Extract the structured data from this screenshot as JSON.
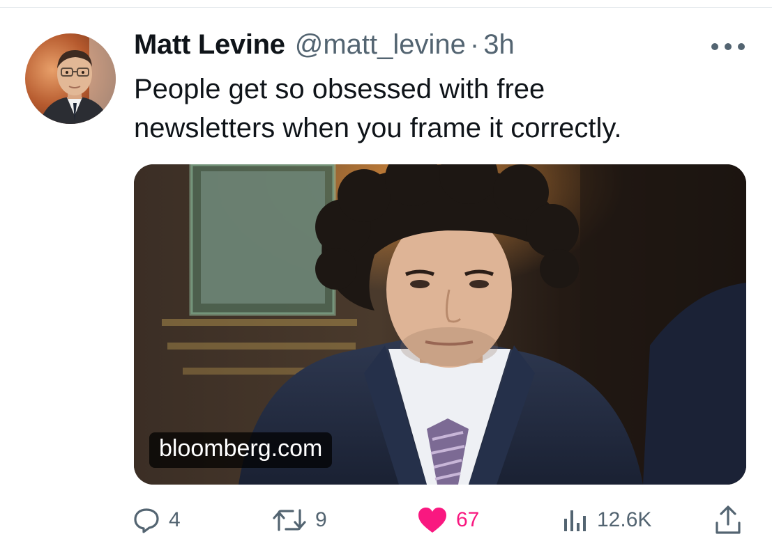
{
  "tweet": {
    "author": {
      "display_name": "Matt Levine",
      "handle": "@matt_levine",
      "separator": "·",
      "time": "3h"
    },
    "text_lines": [
      "People get so obsessed with free",
      "newsletters when you frame it correctly."
    ],
    "card": {
      "domain": "bloomberg.com"
    },
    "actions": {
      "replies": "4",
      "retweets": "9",
      "likes": "67",
      "views": "12.6K"
    }
  },
  "icons": {
    "more": "more-icon",
    "reply": "reply-icon",
    "retweet": "retweet-icon",
    "like": "heart-icon",
    "views": "views-icon",
    "share": "share-icon"
  },
  "colors": {
    "text_primary": "#0f1419",
    "text_secondary": "#536471",
    "like_active": "#f91880"
  }
}
